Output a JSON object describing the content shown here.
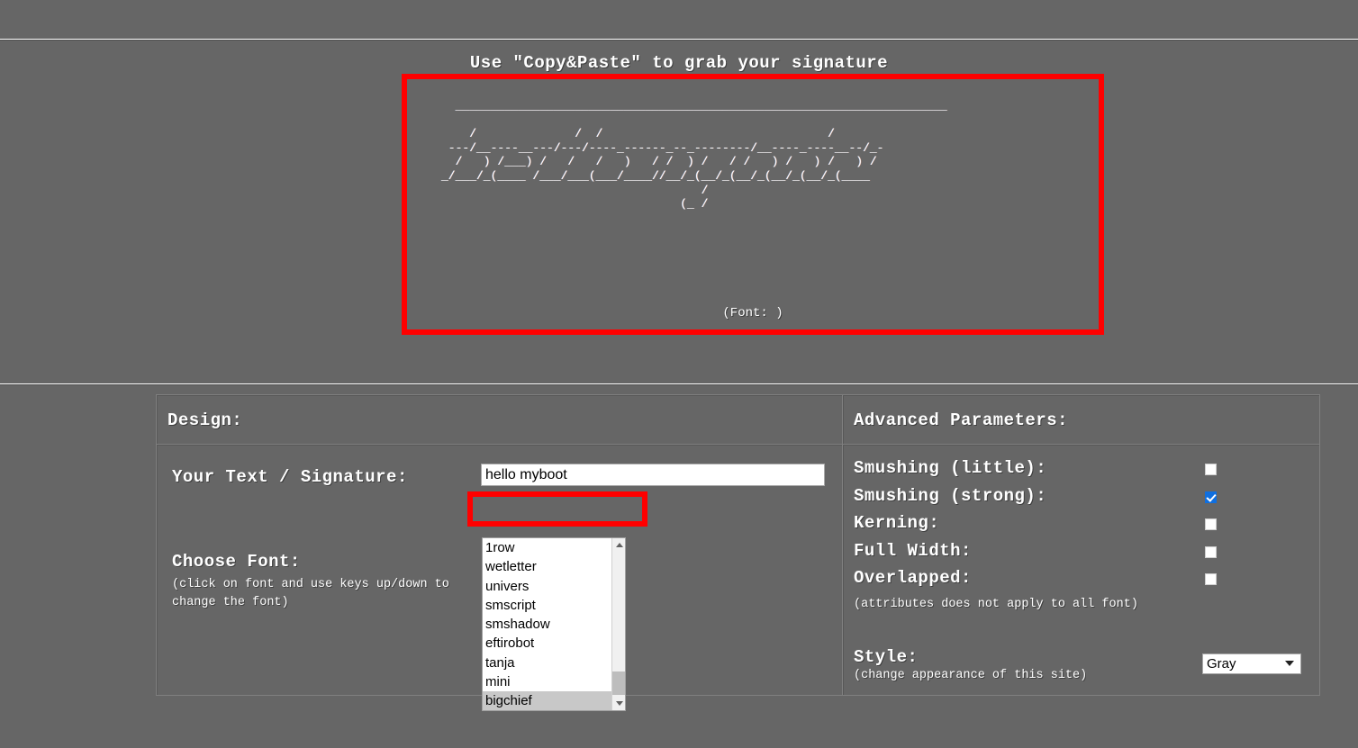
{
  "header": {
    "title": "Use \"Copy&Paste\" to grab your signature"
  },
  "preview": {
    "ascii_art": "  ______________________________________________________________________\n\n    /              /  /                                /\n ---/__----__---/---/----_------_--_--------/__----_----__--/_-\n  /   ) /___) /   /   /   )   / /  ) /   / /   ) /   ) /   ) /\n_/___/_(____ /___/___(___/____//__/_(__/_(__/_(__/_(__/_(____\n                                     /\n                                  (_ /",
    "font_note": "(Font: )",
    "highlight_color": "#ff0000"
  },
  "design_panel": {
    "title": "Design:",
    "signature_label": "Your Text / Signature:",
    "signature_value": "hello myboot",
    "font_label": "Choose Font:",
    "font_hint": "(click on font and use keys up/down to change the font)",
    "font_options": [
      "1row",
      "wetletter",
      "univers",
      "smscript",
      "smshadow",
      "eftirobot",
      "tanja",
      "mini",
      "bigchief"
    ],
    "font_selected": "bigchief"
  },
  "advanced_panel": {
    "title": "Advanced Parameters:",
    "params": [
      {
        "label": "Smushing (little):",
        "checked": false
      },
      {
        "label": "Smushing (strong):",
        "checked": true
      },
      {
        "label": "Kerning:",
        "checked": false
      },
      {
        "label": "Full Width:",
        "checked": false
      },
      {
        "label": "Overlapped:",
        "checked": false
      }
    ],
    "params_note": "(attributes does not apply to all font)",
    "style_label": "Style:",
    "style_note": "(change appearance of this site)",
    "style_value": "Gray",
    "accent_checked_color": "#0f6fe0"
  }
}
